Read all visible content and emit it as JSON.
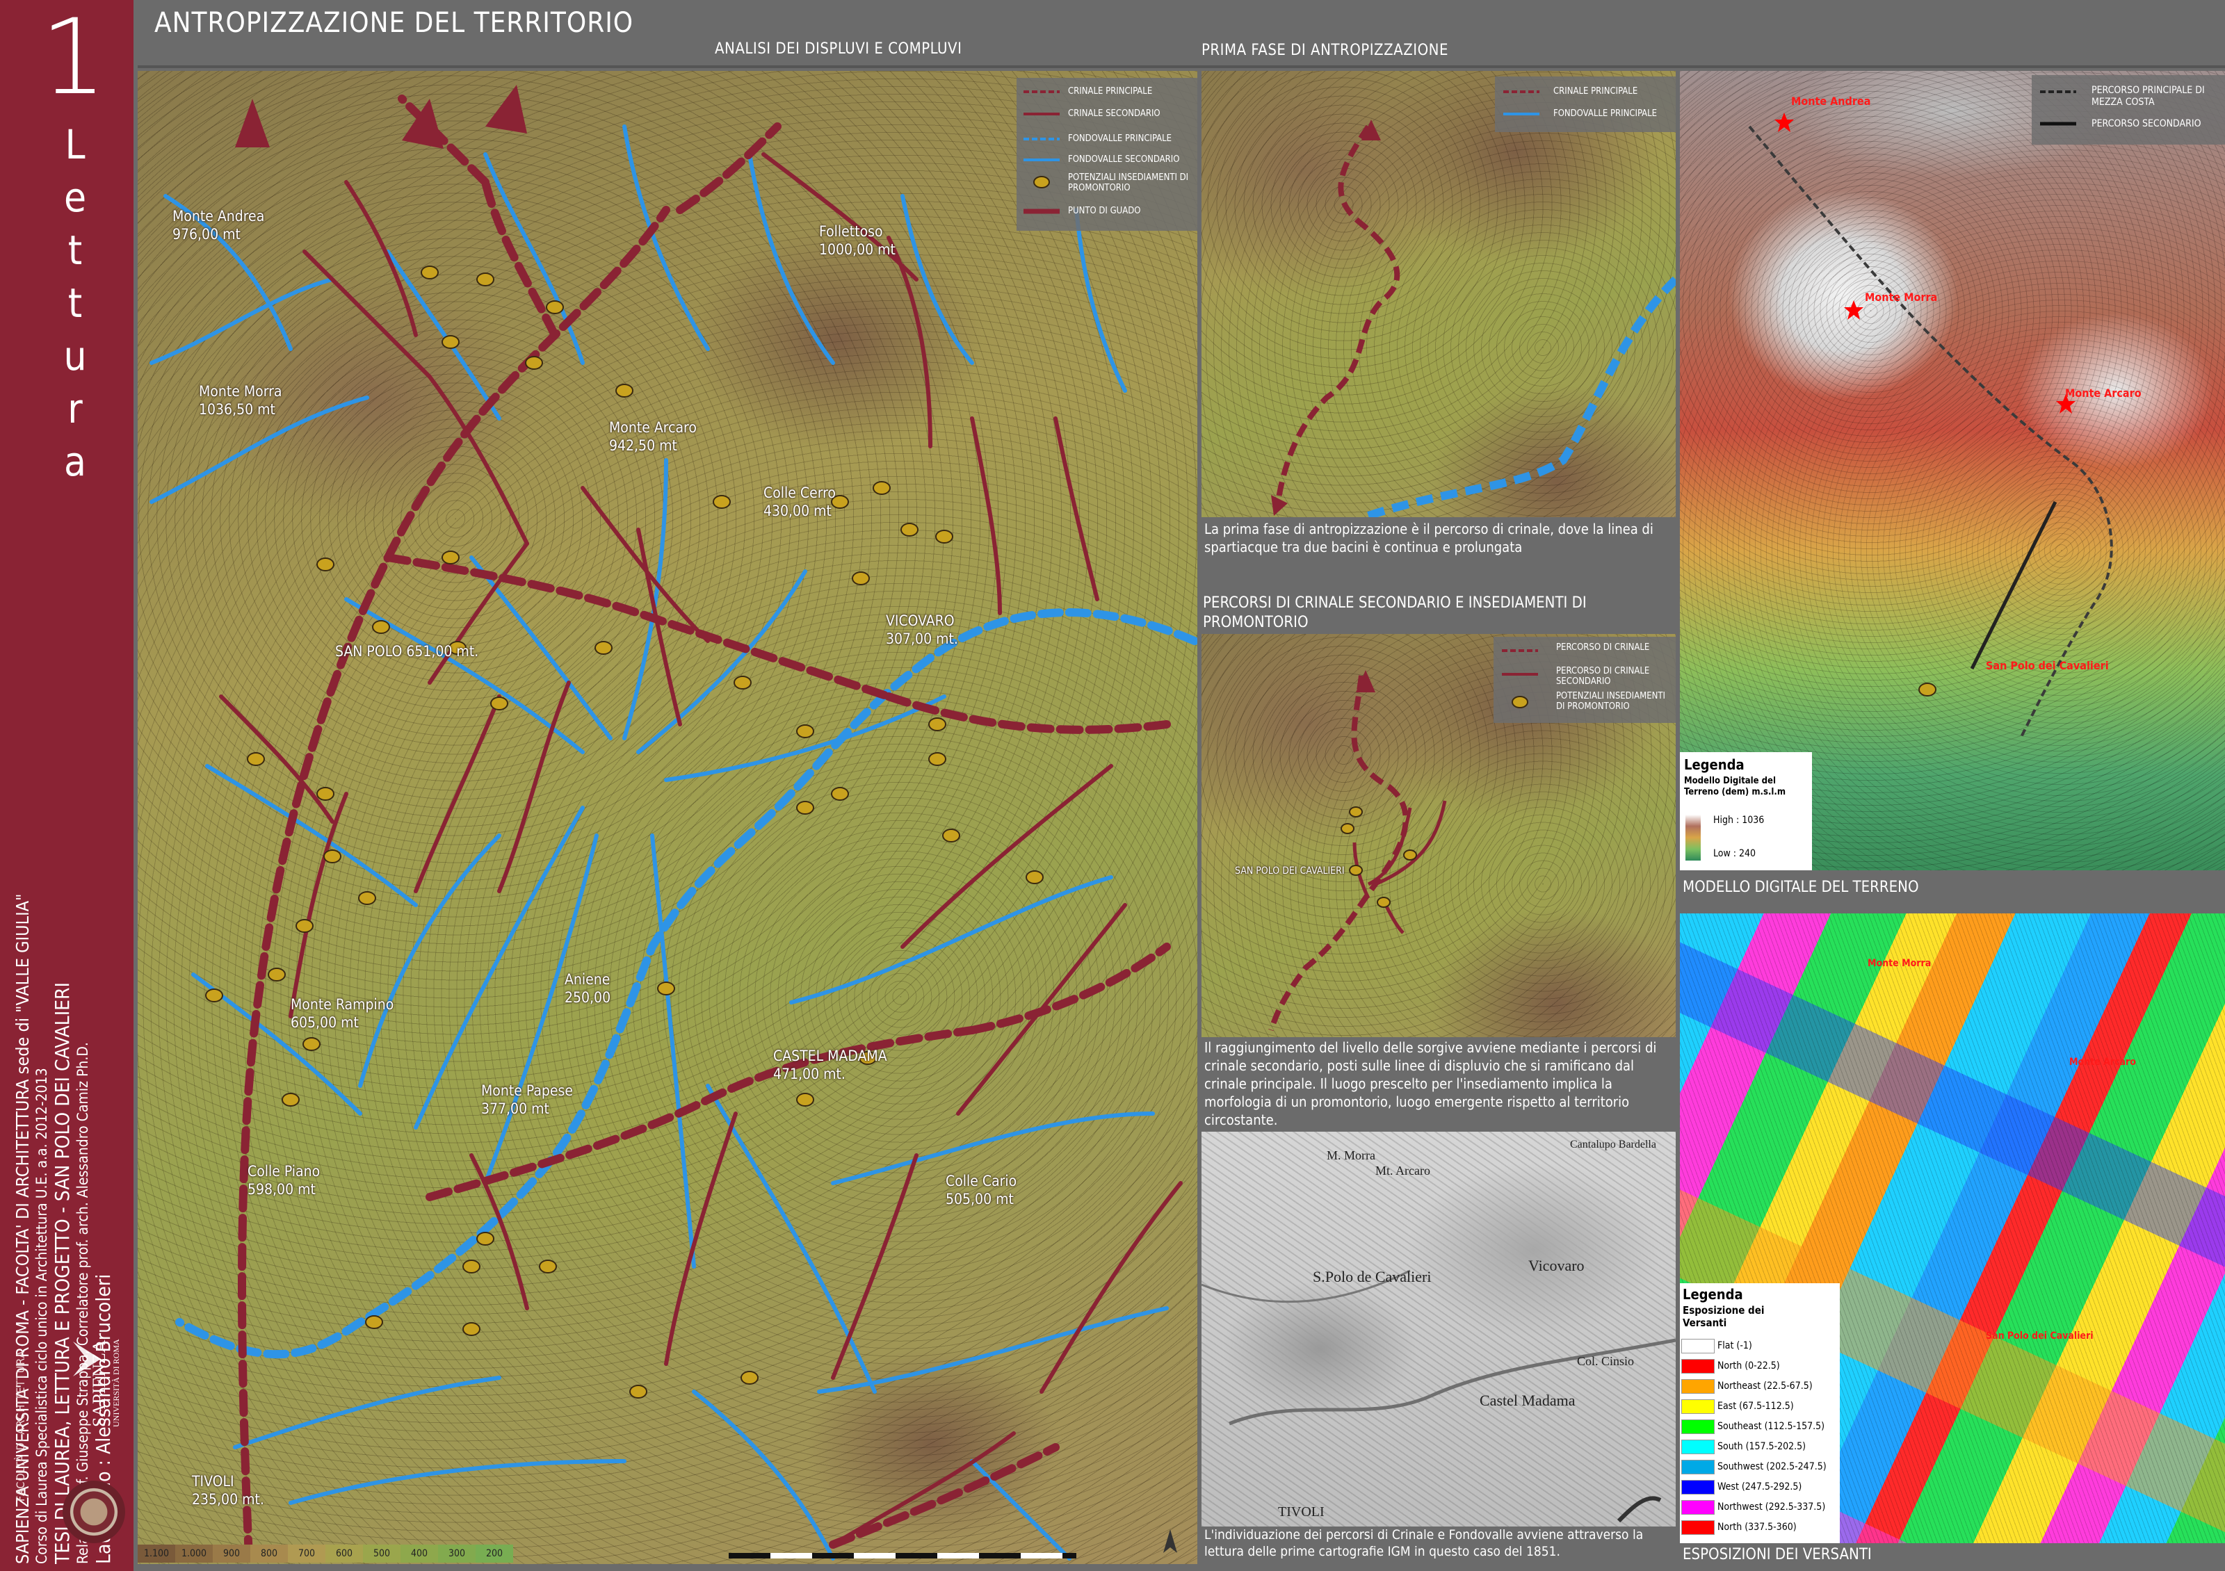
{
  "sidebar": {
    "number": "1",
    "word": "Lettura",
    "credits_line1": "SAPIENZA UNIVERSITA' DI ROMA - FACOLTA' DI ARCHITETTURA sede di \"VALLE GIULIA\"",
    "credits_line2": "Corso di Laurea Specialistica ciclo unico in Architettura U.E.     a.a. 2012-2013",
    "credits_line3": "TESI DI LAUREA, LETTURA E PROGETTO - SAN POLO DEI CAVALIERI",
    "credits_line4": "Relatore prof. Giuseppe Strappa, Correlatore prof. arch. Alessandro Camiz Ph.D.",
    "credits_line5": "Laureando : Alessandro Brucoleri",
    "faculty": "FACOLTÀ DI ARCHITETTURA",
    "logo_name": "SAPIENZA",
    "logo_sub": "UNIVERSITÀ DI ROMA"
  },
  "header": {
    "title": "ANTROPIZZAZIONE DEL TERRITORIO",
    "sub_left": "ANALISI DEI DISPLUVI E COMPLUVI",
    "sub_right": "PRIMA FASE DI ANTROPIZZAZIONE"
  },
  "main_map": {
    "legend": {
      "items": [
        {
          "label": "CRINALE PRINCIPALE",
          "color": "#8a2334",
          "style": "dashed"
        },
        {
          "label": "CRINALE SECONDARIO",
          "color": "#8a2334",
          "style": "solid"
        },
        {
          "label": "FONDOVALLE PRINCIPALE",
          "color": "#2f8fe0",
          "style": "dashed"
        },
        {
          "label": "FONDOVALLE SECONDARIO",
          "color": "#2f8fe0",
          "style": "solid"
        },
        {
          "label": "POTENZIALI INSEDIAMENTI DI PROMONTORIO",
          "color": "#c9a21e",
          "style": "dot"
        },
        {
          "label": "PUNTO DI GUADO",
          "color": "#8a2334",
          "style": "ford"
        }
      ]
    },
    "places": [
      {
        "name": "Monte Andrea",
        "alt": "976,00 mt"
      },
      {
        "name": "Follettoso",
        "alt": "1000,00 mt"
      },
      {
        "name": "Monte Morra",
        "alt": "1036,50 mt"
      },
      {
        "name": "Monte Arcaro",
        "alt": "942,50 mt"
      },
      {
        "name": "Colle Cerro",
        "alt": "430,00 mt"
      },
      {
        "name": "VICOVARO",
        "alt": "307,00 mt."
      },
      {
        "name": "SAN POLO 651,00 mt.",
        "alt": ""
      },
      {
        "name": "Aniene",
        "alt": "250,00"
      },
      {
        "name": "Monte Rampino",
        "alt": "605,00 mt"
      },
      {
        "name": "CASTEL MADAMA",
        "alt": "471,00 mt."
      },
      {
        "name": "Monte Papese",
        "alt": "377,00 mt"
      },
      {
        "name": "Colle Piano",
        "alt": "598,00 mt"
      },
      {
        "name": "Colle Cario",
        "alt": "505,00 mt"
      },
      {
        "name": "TIVOLI",
        "alt": "235,00 mt."
      }
    ],
    "elevation_scale": [
      "1.100",
      "1.000",
      "900",
      "800",
      "700",
      "600",
      "500",
      "400",
      "300",
      "200"
    ],
    "elevation_colors": [
      "#7a5a3a",
      "#8a6a40",
      "#9a7a48",
      "#a88a4e",
      "#b09a52",
      "#a8a24e",
      "#9aa64c",
      "#8ea84c",
      "#82aa4e",
      "#78ad52"
    ]
  },
  "phase1": {
    "legend": [
      {
        "label": "CRINALE PRINCIPALE"
      },
      {
        "label": "FONDOVALLE PRINCIPALE"
      }
    ],
    "caption": "La prima fase di antropizzazione è il percorso di crinale, dove la linea di spartiacque tra due bacini è continua e prolungata"
  },
  "phase2": {
    "title": "PERCORSI DI CRINALE SECONDARIO E INSEDIAMENTI DI PROMONTORIO",
    "legend": [
      {
        "label": "PERCORSO DI CRINALE"
      },
      {
        "label": "PERCORSO DI CRINALE SECONDARIO"
      },
      {
        "label": "POTENZIALI INSEDIAMENTI DI PROMONTORIO"
      }
    ],
    "place": "SAN POLO DEI CAVALIERI",
    "caption": "Il raggiungimento del livello delle sorgive avviene mediante i percorsi di crinale secondario, posti sulle linee di displuvio che si ramificano dal crinale principale. Il luogo prescelto per l'insediamento implica la morfologia di un promontorio, luogo emergente rispetto al territorio circostante."
  },
  "igm": {
    "caption": "L'individuazione dei percorsi di Crinale e Fondovalle avviene attraverso la lettura delle prime cartografie IGM in questo caso del 1851.",
    "places": [
      "M. Morra",
      "Mt. Arcaro",
      "Vicovaro",
      "S.Polo de Cavalieri",
      "Castel Madama",
      "TIVOLI",
      "Cantalupo Bardella",
      "Col. Cinsio"
    ]
  },
  "dem": {
    "legend": [
      {
        "label": "PERCORSO PRINCIPALE DI MEZZA COSTA"
      },
      {
        "label": "PERCORSO SECONDARIO"
      }
    ],
    "places": [
      "Monte Andrea",
      "Monte Morra",
      "Monte Arcaro",
      "San Polo dei Cavalieri"
    ],
    "legenda_title": "Legenda",
    "legenda_sub": "Modello Digitale del Terreno (dem) m.s.l.m",
    "high": "High : 1036",
    "low": "Low : 240",
    "footer": "MODELLO DIGITALE DEL TERRENO"
  },
  "aspect": {
    "legenda_title": "Legenda",
    "legenda_sub": "Esposizione dei Versanti",
    "classes": [
      {
        "label": "Flat (-1)",
        "color": "#ffffff"
      },
      {
        "label": "North (0-22.5)",
        "color": "#ff0000"
      },
      {
        "label": "Northeast (22.5-67.5)",
        "color": "#ffa500"
      },
      {
        "label": "East (67.5-112.5)",
        "color": "#ffff00"
      },
      {
        "label": "Southeast (112.5-157.5)",
        "color": "#00ff00"
      },
      {
        "label": "South (157.5-202.5)",
        "color": "#00ffff"
      },
      {
        "label": "Southwest (202.5-247.5)",
        "color": "#00a9e6"
      },
      {
        "label": "West (247.5-292.5)",
        "color": "#0000ff"
      },
      {
        "label": "Northwest (292.5-337.5)",
        "color": "#ff00ff"
      },
      {
        "label": "North (337.5-360)",
        "color": "#ff0000"
      }
    ],
    "places": [
      "Monte Morra",
      "Monte Arcaro",
      "San Polo dei Cavalieri"
    ],
    "footer": "ESPOSIZIONI DEI VERSANTI"
  }
}
